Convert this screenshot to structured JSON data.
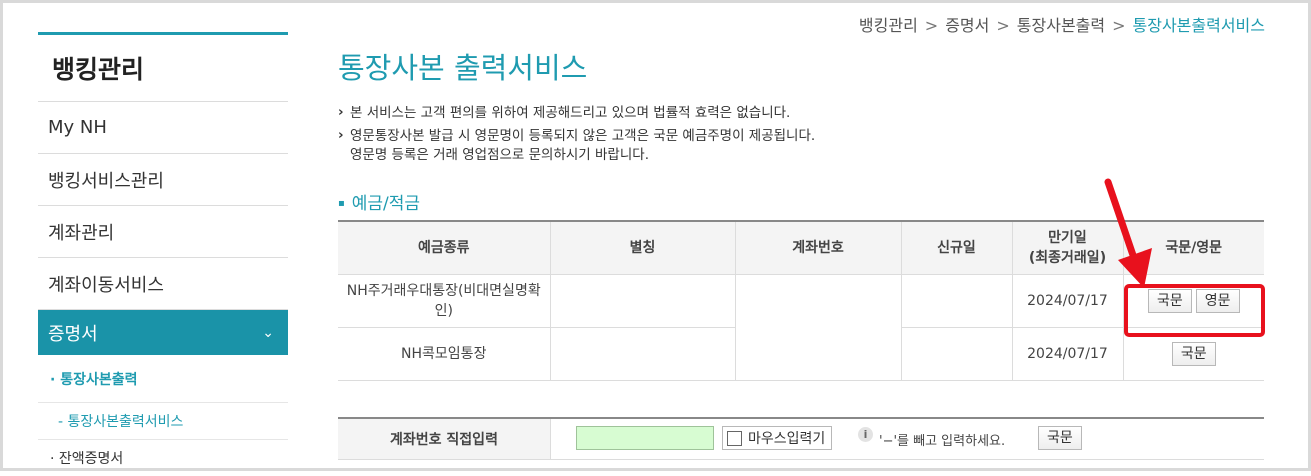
{
  "breadcrumb": [
    "뱅킹관리",
    "증명서",
    "통장사본출력",
    "통장사본출력서비스"
  ],
  "sidebar": {
    "title": "뱅킹관리",
    "items": [
      {
        "label": "My NH"
      },
      {
        "label": "뱅킹서비스관리"
      },
      {
        "label": "계좌관리"
      },
      {
        "label": "계좌이동서비스"
      }
    ],
    "active": {
      "label": "증명서",
      "chevron": "⌄"
    },
    "sub": "· 통장사본출력",
    "sub2": "- 통장사본출력서비스",
    "sub3": "· 잔액증명서"
  },
  "main": {
    "title": "통장사본 출력서비스",
    "notices": [
      "본 서비스는 고객 편의를 위하여 제공해드리고 있으며 법률적 효력은 없습니다.",
      "영문통장사본 발급 시 영문명이 등록되지 않은 고객은 국문 예금주명이 제공됩니다.",
      "영문명 등록은 거래 영업점으로 문의하시기 바랍니다."
    ],
    "section": "예금/적금",
    "table": {
      "headers": [
        "예금종류",
        "별칭",
        "계좌번호",
        "신규일",
        "만기일",
        "(최종거래일)",
        "국문/영문"
      ],
      "rows": [
        {
          "type": "NH주거래우대통장(비대면실명확인)",
          "maturity": "2024/07/17",
          "btn_ko": "국문",
          "btn_en": "영문"
        },
        {
          "type": "NH콕모임통장",
          "maturity": "2024/07/17",
          "btn_ko": "국문"
        }
      ]
    }
  },
  "direct": {
    "label": "계좌번호 직접입력",
    "mouse_label": "마우스입력기",
    "info": "i",
    "hint": "'−'를 빼고 입력하세요.",
    "button": "국문"
  },
  "colors": {
    "accent": "#1f9bb0",
    "highlight": "#e8111d"
  }
}
